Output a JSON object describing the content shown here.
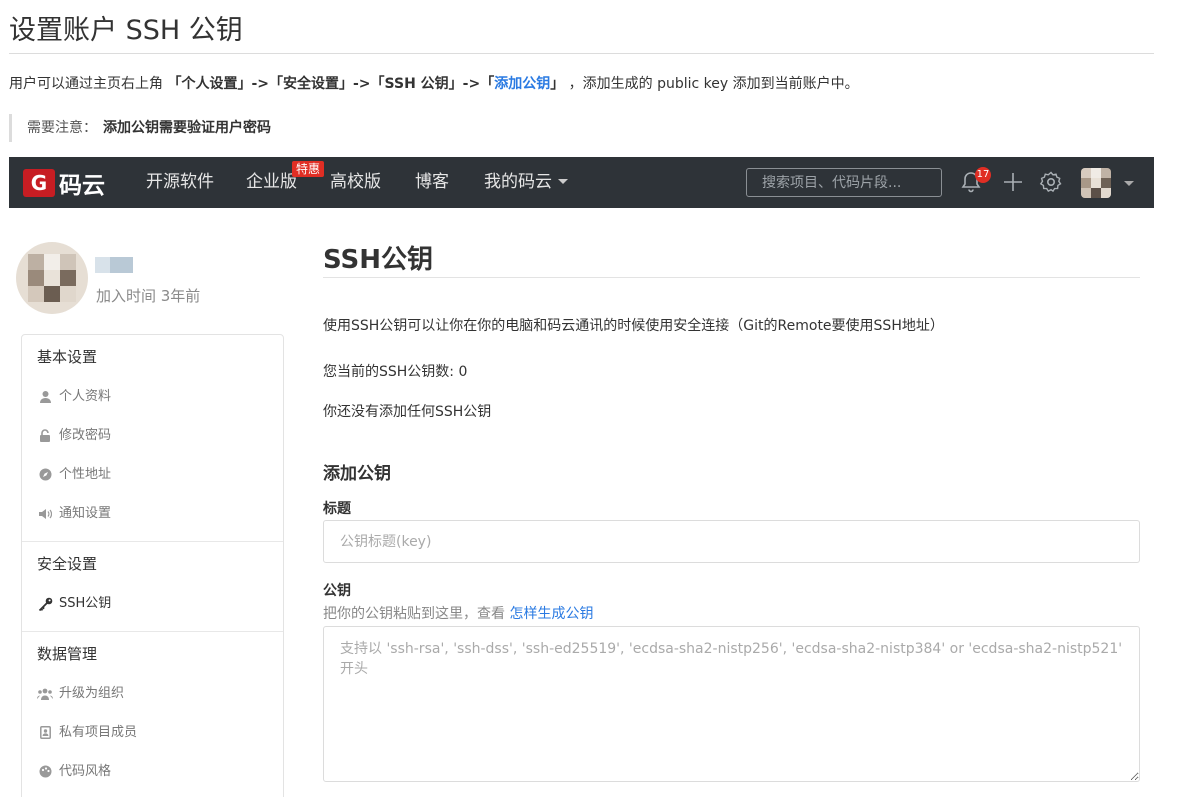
{
  "doc": {
    "title": "设置账户 SSH 公钥",
    "intro_prefix": "用户可以通过主页右上角",
    "path1": "「个人设置」->「安全设置」->「SSH 公钥」->「",
    "path_link": "添加公钥",
    "path2": "」",
    "intro_suffix": "，添加生成的 public key 添加到当前账户中。",
    "note_label": "需要注意：",
    "note_text": "添加公钥需要验证用户密码"
  },
  "navbar": {
    "logo_letter": "G",
    "logo_text": "码云",
    "items": [
      "开源软件",
      "企业版",
      "高校版",
      "博客",
      "我的码云"
    ],
    "enterprise_badge": "特惠",
    "search_placeholder": "搜索项目、代码片段...",
    "notification_count": "17",
    "colors": {
      "bar": "#2e3338",
      "badge": "#e02e24",
      "logo": "#c71d23"
    }
  },
  "profile": {
    "joined": "加入时间 3年前"
  },
  "sidebar": {
    "groups": [
      {
        "title": "基本设置",
        "items": [
          {
            "label": "个人资料",
            "icon": "user-icon"
          },
          {
            "label": "修改密码",
            "icon": "lock-icon"
          },
          {
            "label": "个性地址",
            "icon": "compass-icon"
          },
          {
            "label": "通知设置",
            "icon": "speaker-icon"
          }
        ]
      },
      {
        "title": "安全设置",
        "items": [
          {
            "label": "SSH公钥",
            "icon": "key-icon",
            "active": true
          }
        ]
      },
      {
        "title": "数据管理",
        "items": [
          {
            "label": "升级为组织",
            "icon": "users-icon"
          },
          {
            "label": "私有项目成员",
            "icon": "contact-icon"
          },
          {
            "label": "代码风格",
            "icon": "palette-icon"
          }
        ]
      }
    ]
  },
  "main": {
    "title": "SSH公钥",
    "description": "使用SSH公钥可以让你在你的电脑和码云通讯的时候使用安全连接（Git的Remote要使用SSH地址）",
    "count_text": "您当前的SSH公钥数: 0",
    "none_text": "你还没有添加任何SSH公钥",
    "add_title": "添加公钥",
    "title_label": "标题",
    "title_placeholder": "公钥标题(key)",
    "key_label": "公钥",
    "key_hint": "把你的公钥粘贴到这里，查看",
    "key_hint_link": "怎样生成公钥",
    "key_placeholder": "支持以 'ssh-rsa', 'ssh-dss', 'ssh-ed25519', 'ecdsa-sha2-nistp256', 'ecdsa-sha2-nistp384' or 'ecdsa-sha2-nistp521' 开头"
  }
}
